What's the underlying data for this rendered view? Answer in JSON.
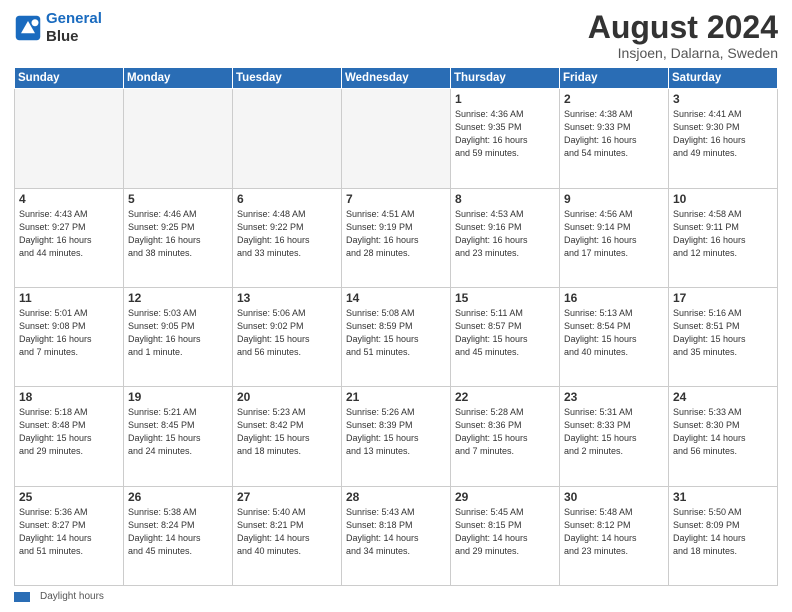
{
  "header": {
    "logo_line1": "General",
    "logo_line2": "Blue",
    "main_title": "August 2024",
    "subtitle": "Insjoen, Dalarna, Sweden"
  },
  "days_of_week": [
    "Sunday",
    "Monday",
    "Tuesday",
    "Wednesday",
    "Thursday",
    "Friday",
    "Saturday"
  ],
  "footer": {
    "legend_label": "Daylight hours"
  },
  "weeks": [
    [
      {
        "day": "",
        "info": ""
      },
      {
        "day": "",
        "info": ""
      },
      {
        "day": "",
        "info": ""
      },
      {
        "day": "",
        "info": ""
      },
      {
        "day": "1",
        "info": "Sunrise: 4:36 AM\nSunset: 9:35 PM\nDaylight: 16 hours\nand 59 minutes."
      },
      {
        "day": "2",
        "info": "Sunrise: 4:38 AM\nSunset: 9:33 PM\nDaylight: 16 hours\nand 54 minutes."
      },
      {
        "day": "3",
        "info": "Sunrise: 4:41 AM\nSunset: 9:30 PM\nDaylight: 16 hours\nand 49 minutes."
      }
    ],
    [
      {
        "day": "4",
        "info": "Sunrise: 4:43 AM\nSunset: 9:27 PM\nDaylight: 16 hours\nand 44 minutes."
      },
      {
        "day": "5",
        "info": "Sunrise: 4:46 AM\nSunset: 9:25 PM\nDaylight: 16 hours\nand 38 minutes."
      },
      {
        "day": "6",
        "info": "Sunrise: 4:48 AM\nSunset: 9:22 PM\nDaylight: 16 hours\nand 33 minutes."
      },
      {
        "day": "7",
        "info": "Sunrise: 4:51 AM\nSunset: 9:19 PM\nDaylight: 16 hours\nand 28 minutes."
      },
      {
        "day": "8",
        "info": "Sunrise: 4:53 AM\nSunset: 9:16 PM\nDaylight: 16 hours\nand 23 minutes."
      },
      {
        "day": "9",
        "info": "Sunrise: 4:56 AM\nSunset: 9:14 PM\nDaylight: 16 hours\nand 17 minutes."
      },
      {
        "day": "10",
        "info": "Sunrise: 4:58 AM\nSunset: 9:11 PM\nDaylight: 16 hours\nand 12 minutes."
      }
    ],
    [
      {
        "day": "11",
        "info": "Sunrise: 5:01 AM\nSunset: 9:08 PM\nDaylight: 16 hours\nand 7 minutes."
      },
      {
        "day": "12",
        "info": "Sunrise: 5:03 AM\nSunset: 9:05 PM\nDaylight: 16 hours\nand 1 minute."
      },
      {
        "day": "13",
        "info": "Sunrise: 5:06 AM\nSunset: 9:02 PM\nDaylight: 15 hours\nand 56 minutes."
      },
      {
        "day": "14",
        "info": "Sunrise: 5:08 AM\nSunset: 8:59 PM\nDaylight: 15 hours\nand 51 minutes."
      },
      {
        "day": "15",
        "info": "Sunrise: 5:11 AM\nSunset: 8:57 PM\nDaylight: 15 hours\nand 45 minutes."
      },
      {
        "day": "16",
        "info": "Sunrise: 5:13 AM\nSunset: 8:54 PM\nDaylight: 15 hours\nand 40 minutes."
      },
      {
        "day": "17",
        "info": "Sunrise: 5:16 AM\nSunset: 8:51 PM\nDaylight: 15 hours\nand 35 minutes."
      }
    ],
    [
      {
        "day": "18",
        "info": "Sunrise: 5:18 AM\nSunset: 8:48 PM\nDaylight: 15 hours\nand 29 minutes."
      },
      {
        "day": "19",
        "info": "Sunrise: 5:21 AM\nSunset: 8:45 PM\nDaylight: 15 hours\nand 24 minutes."
      },
      {
        "day": "20",
        "info": "Sunrise: 5:23 AM\nSunset: 8:42 PM\nDaylight: 15 hours\nand 18 minutes."
      },
      {
        "day": "21",
        "info": "Sunrise: 5:26 AM\nSunset: 8:39 PM\nDaylight: 15 hours\nand 13 minutes."
      },
      {
        "day": "22",
        "info": "Sunrise: 5:28 AM\nSunset: 8:36 PM\nDaylight: 15 hours\nand 7 minutes."
      },
      {
        "day": "23",
        "info": "Sunrise: 5:31 AM\nSunset: 8:33 PM\nDaylight: 15 hours\nand 2 minutes."
      },
      {
        "day": "24",
        "info": "Sunrise: 5:33 AM\nSunset: 8:30 PM\nDaylight: 14 hours\nand 56 minutes."
      }
    ],
    [
      {
        "day": "25",
        "info": "Sunrise: 5:36 AM\nSunset: 8:27 PM\nDaylight: 14 hours\nand 51 minutes."
      },
      {
        "day": "26",
        "info": "Sunrise: 5:38 AM\nSunset: 8:24 PM\nDaylight: 14 hours\nand 45 minutes."
      },
      {
        "day": "27",
        "info": "Sunrise: 5:40 AM\nSunset: 8:21 PM\nDaylight: 14 hours\nand 40 minutes."
      },
      {
        "day": "28",
        "info": "Sunrise: 5:43 AM\nSunset: 8:18 PM\nDaylight: 14 hours\nand 34 minutes."
      },
      {
        "day": "29",
        "info": "Sunrise: 5:45 AM\nSunset: 8:15 PM\nDaylight: 14 hours\nand 29 minutes."
      },
      {
        "day": "30",
        "info": "Sunrise: 5:48 AM\nSunset: 8:12 PM\nDaylight: 14 hours\nand 23 minutes."
      },
      {
        "day": "31",
        "info": "Sunrise: 5:50 AM\nSunset: 8:09 PM\nDaylight: 14 hours\nand 18 minutes."
      }
    ]
  ]
}
